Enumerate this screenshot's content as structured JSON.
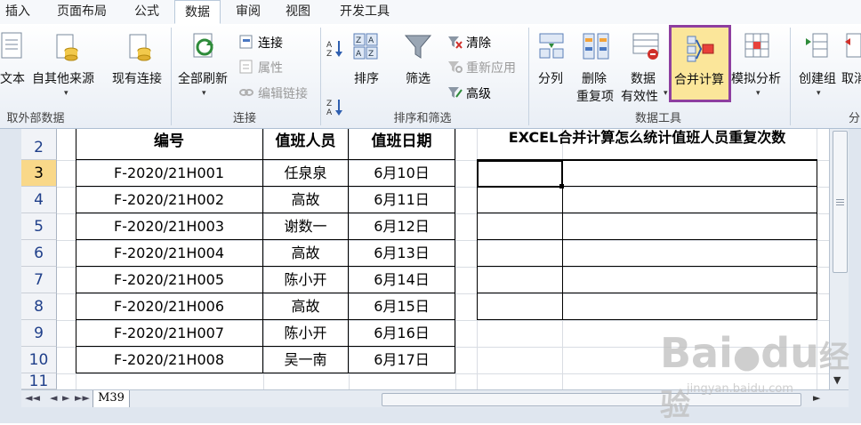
{
  "tabs": [
    "插入",
    "页面布局",
    "公式",
    "数据",
    "审阅",
    "视图",
    "开发工具"
  ],
  "active_tab": "数据",
  "ribbon": {
    "get_external": {
      "text_label": "文本",
      "other_sources_label": "自其他来源",
      "existing_conn_label": "现有连接",
      "group_label": "取外部数据"
    },
    "connections": {
      "refresh_all_label": "全部刷新",
      "connections_label": "连接",
      "properties_label": "属性",
      "edit_links_label": "编辑链接",
      "group_label": "连接"
    },
    "sort_filter": {
      "sort_label": "排序",
      "filter_label": "筛选",
      "clear_label": "清除",
      "reapply_label": "重新应用",
      "advanced_label": "高级",
      "group_label": "排序和筛选"
    },
    "data_tools": {
      "text_to_columns_label": "分列",
      "remove_dup_line1": "删除",
      "remove_dup_line2": "重复项",
      "validation_line1": "数据",
      "validation_line2": "有效性",
      "consolidate_label": "合并计算",
      "what_if_label": "模拟分析",
      "group_label": "数据工具"
    },
    "outline": {
      "group_create_label": "创建组",
      "ungroup_label": "取消",
      "group_label": "分"
    }
  },
  "sheet": {
    "row_numbers": [
      "2",
      "3",
      "4",
      "5",
      "6",
      "7",
      "8",
      "9",
      "10",
      "11"
    ],
    "selected_row": "3",
    "headers": [
      "编号",
      "值班人员",
      "值班日期"
    ],
    "rows": [
      [
        "F-2020/21H001",
        "任泉泉",
        "6月10日"
      ],
      [
        "F-2020/21H002",
        "高故",
        "6月11日"
      ],
      [
        "F-2020/21H003",
        "谢数一",
        "6月12日"
      ],
      [
        "F-2020/21H004",
        "高故",
        "6月13日"
      ],
      [
        "F-2020/21H005",
        "陈小开",
        "6月14日"
      ],
      [
        "F-2020/21H006",
        "高故",
        "6月15日"
      ],
      [
        "F-2020/21H007",
        "陈小开",
        "6月16日"
      ],
      [
        "F-2020/21H008",
        "吴一南",
        "6月17日"
      ]
    ],
    "result_title": "EXCEL合并计算怎么统计值班人员重复次数",
    "sheet_tab": "M39"
  },
  "watermark": {
    "brand": "Bai",
    "brand2": "du",
    "cn": "经验",
    "url": "jingyan.baidu.com"
  }
}
